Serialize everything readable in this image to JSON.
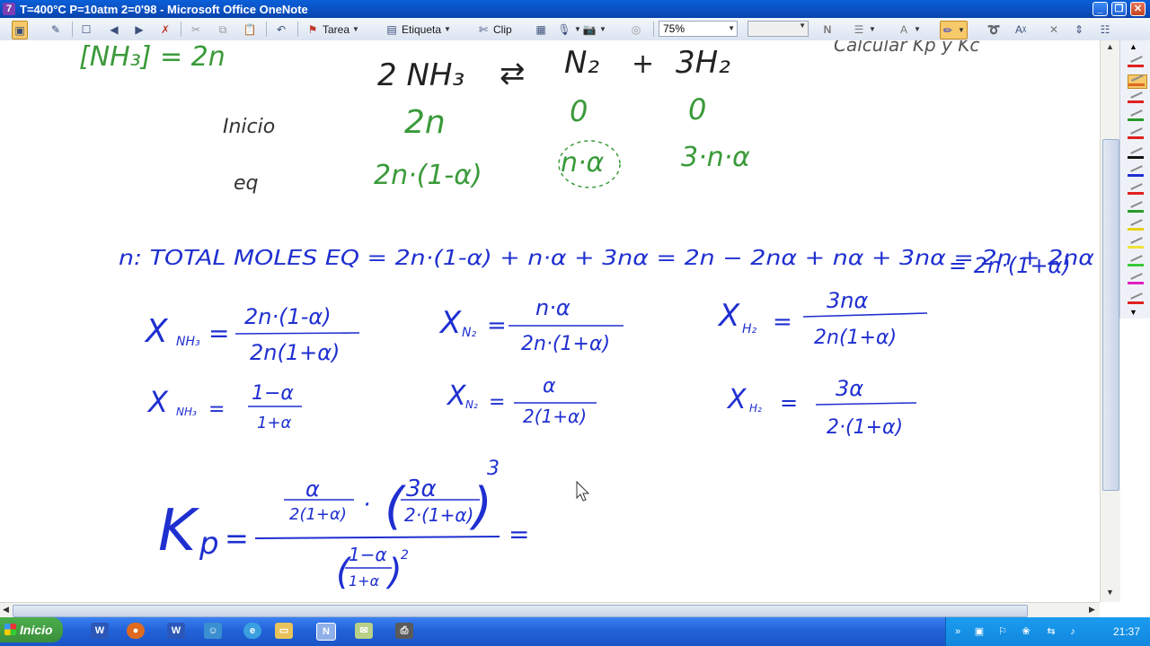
{
  "window": {
    "title": "T=400°C P=10atm 2=0'98 - Microsoft Office OneNote"
  },
  "toolbar": {
    "tag_label": "Tarea",
    "label_label": "Etiqueta",
    "clip_label": "Clip",
    "zoom_value": "75%"
  },
  "note": {
    "corner": "[NH₃] = 2n",
    "reaction": {
      "reactant": "2 NH₃",
      "arrow": "⇄",
      "product1": "N₂",
      "plus": "+",
      "product2": "3H₂"
    },
    "row_inicio": {
      "label": "Inicio",
      "nh3": "2n",
      "n2": "0",
      "h2": "0"
    },
    "row_eq": {
      "label": "eq",
      "nh3": "2n·(1-α)",
      "n2": "n·α",
      "h2": "3·n·α"
    },
    "total_line1": "n: TOTAL MOLES EQ = 2n·(1-α) + n·α + 3nα = 2n − 2nα + nα + 3nα = 2n + 2nα",
    "total_line2": "= 2n·(1+α)",
    "frac1": {
      "lhs": "X",
      "lhs_sub": "NH₃",
      "num": "2n·(1-α)",
      "den": "2n(1+α)"
    },
    "frac2": {
      "lhs": "X",
      "lhs_sub": "N₂",
      "num": "n·α",
      "den": "2n·(1+α)"
    },
    "frac3": {
      "lhs": "X",
      "lhs_sub": "H₂",
      "num": "3nα",
      "den": "2n(1+α)"
    },
    "frac4": {
      "lhs": "X",
      "lhs_sub": "NH₃",
      "num": "1−α",
      "den": "1+α"
    },
    "frac5": {
      "lhs": "X",
      "lhs_sub": "N₂",
      "num": "α",
      "den": "2(1+α)"
    },
    "frac6": {
      "lhs": "X",
      "lhs_sub": "H₂",
      "num": "3α",
      "den": "2·(1+α)"
    },
    "kp": {
      "lhs": "K",
      "lhs_sub": "p",
      "t1_num": "α",
      "t1_den": "2(1+α)",
      "dot": "·",
      "t2_num": "3α",
      "t2_den": "2·(1+α)",
      "t2_exp": "3",
      "den_num": "1−α",
      "den_den": "1+α",
      "den_exp": "2"
    },
    "top_right": "Calcular Kp y Kc"
  },
  "taskbar": {
    "start_label": "Inicio",
    "clock": "21:37"
  },
  "colors": {
    "green": "#3a9a3a",
    "blue": "#1f2fd0",
    "black": "#222222",
    "title_bar": "#0b4fc0"
  }
}
